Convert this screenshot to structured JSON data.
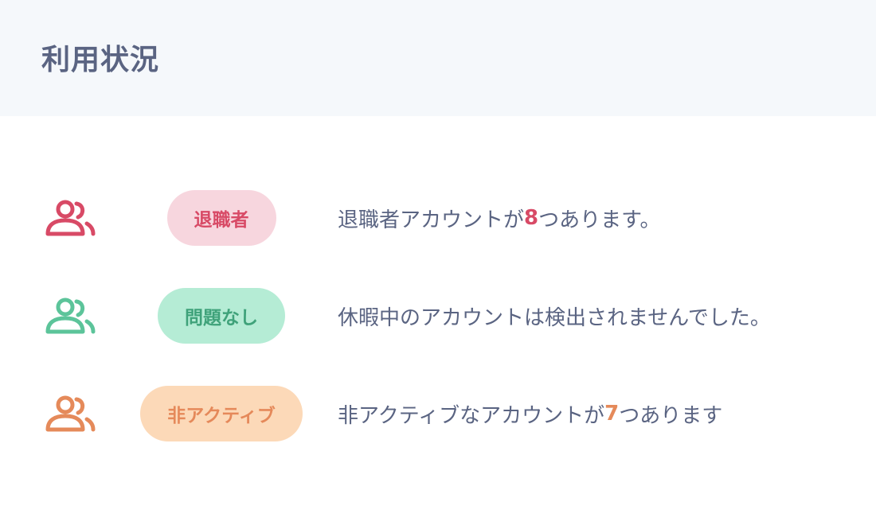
{
  "header": {
    "title": "利用状況"
  },
  "rows": [
    {
      "icon": "users-icon",
      "color": "#d84a66",
      "badge": {
        "label": "退職者",
        "bg": "#f7d6de",
        "fg": "#d84a66"
      },
      "message_before": "退職者アカウントが",
      "count": "8",
      "message_after": "つあります。"
    },
    {
      "icon": "users-icon",
      "color": "#5cc49a",
      "badge": {
        "label": "問題なし",
        "bg": "#b5ecd5",
        "fg": "#3fa27a"
      },
      "message_before": "休暇中のアカウントは検出されませんでした。",
      "count": "",
      "message_after": ""
    },
    {
      "icon": "users-icon",
      "color": "#e58a5a",
      "badge": {
        "label": "非アクティブ",
        "bg": "#fcd9b8",
        "fg": "#e5895a"
      },
      "message_before": "非アクティブなアカウントが",
      "count": "7",
      "message_after": "つあります"
    }
  ]
}
